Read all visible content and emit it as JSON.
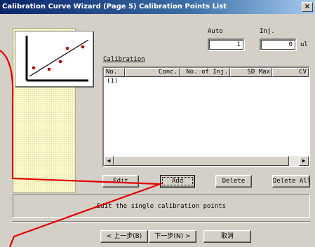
{
  "window": {
    "title": "Calibration Curve Wizard (Page 5) Calibration Points List"
  },
  "fields": {
    "auto_label": "Auto",
    "auto_value": "1",
    "inj_label": "Inj.",
    "inj_value": "0",
    "inj_unit": "ul",
    "calibration_label": "Calibration"
  },
  "list": {
    "columns": [
      "No.",
      "Conc.",
      "No. of Inj.",
      "SD Max",
      "CV"
    ],
    "rows": [
      "(1)"
    ]
  },
  "buttons": {
    "edit": "Edit",
    "add": "Add",
    "delete": "Delete",
    "delete_all": "Delete All"
  },
  "hint": "Edit the single calibration points",
  "nav": {
    "back": "< 上一步(B)",
    "next": "下一步(N) >",
    "cancel": "取消"
  },
  "colors": {
    "accent_line": "#e00000",
    "titlebar": "#0a246a",
    "panel": "#ffffcc"
  }
}
